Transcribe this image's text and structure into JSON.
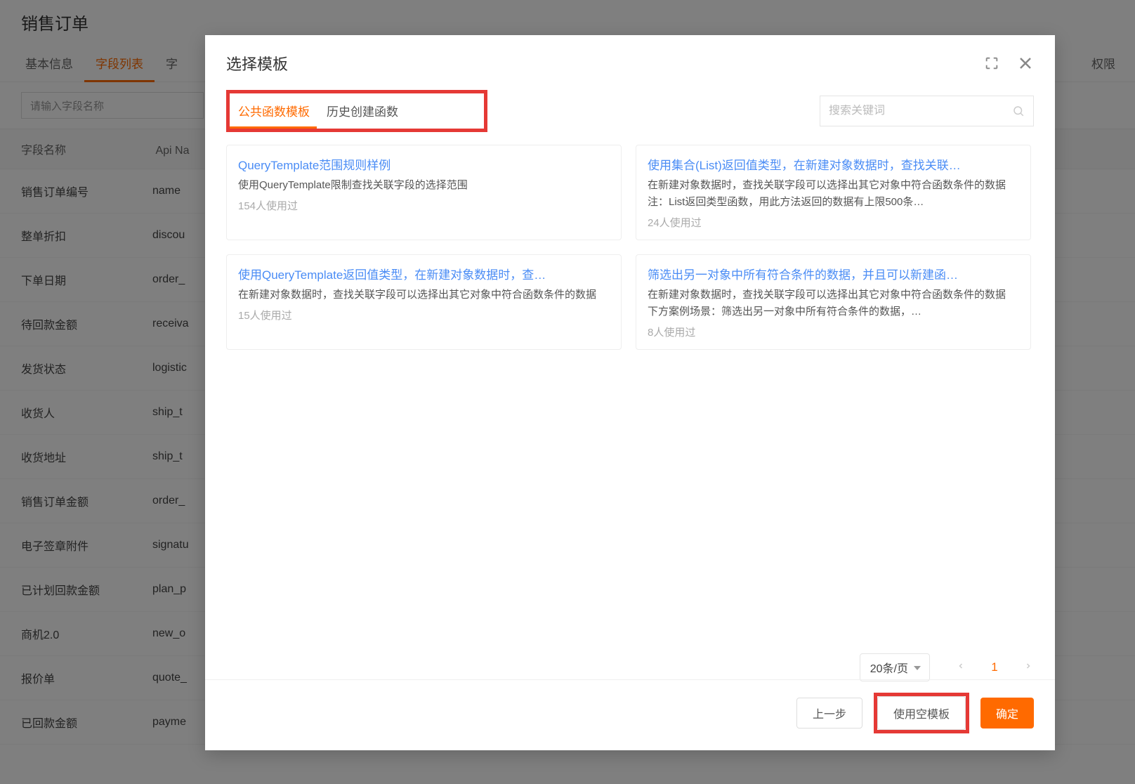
{
  "background": {
    "page_title": "销售订单",
    "tabs": [
      "基本信息",
      "字段列表",
      "字",
      "权限"
    ],
    "active_tab_index": 1,
    "search_placeholder": "请输入字段名称",
    "columns": [
      "字段名称",
      "Api Na"
    ],
    "rows": [
      {
        "name": "销售订单编号",
        "api": "name"
      },
      {
        "name": "整单折扣",
        "api": "discou"
      },
      {
        "name": "下单日期",
        "api": "order_"
      },
      {
        "name": "待回款金额",
        "api": "receiva"
      },
      {
        "name": "发货状态",
        "api": "logistic"
      },
      {
        "name": "收货人",
        "api": "ship_t"
      },
      {
        "name": "收货地址",
        "api": "ship_t"
      },
      {
        "name": "销售订单金额",
        "api": "order_"
      },
      {
        "name": "电子签章附件",
        "api": "signatu"
      },
      {
        "name": "已计划回款金额",
        "api": "plan_p"
      },
      {
        "name": "商机2.0",
        "api": "new_o"
      },
      {
        "name": "报价单",
        "api": "quote_"
      },
      {
        "name": "已回款金额",
        "api": "payme"
      }
    ]
  },
  "modal": {
    "title": "选择模板",
    "tabs": [
      "公共函数模板",
      "历史创建函数"
    ],
    "active_tab_index": 0,
    "search_placeholder": "搜索关键词",
    "cards": [
      {
        "title": "QueryTemplate范围规则样例",
        "desc": "使用QueryTemplate限制查找关联字段的选择范围",
        "meta": "154人使用过"
      },
      {
        "title": "使用集合(List)返回值类型，在新建对象数据时，查找关联…",
        "desc": "在新建对象数据时，查找关联字段可以选择出其它对象中符合函数条件的数据 注：List返回类型函数，用此方法返回的数据有上限500条…",
        "meta": "24人使用过"
      },
      {
        "title": "使用QueryTemplate返回值类型，在新建对象数据时，查…",
        "desc": "在新建对象数据时，查找关联字段可以选择出其它对象中符合函数条件的数据",
        "meta": "15人使用过"
      },
      {
        "title": "筛选出另一对象中所有符合条件的数据，并且可以新建函…",
        "desc": "在新建对象数据时，查找关联字段可以选择出其它对象中符合函数条件的数据 下方案例场景：筛选出另一对象中所有符合条件的数据，…",
        "meta": "8人使用过"
      }
    ],
    "pagination": {
      "page_size_label": "20条/页",
      "current": "1"
    },
    "footer": {
      "prev": "上一步",
      "blank_template": "使用空模板",
      "confirm": "确定"
    }
  }
}
